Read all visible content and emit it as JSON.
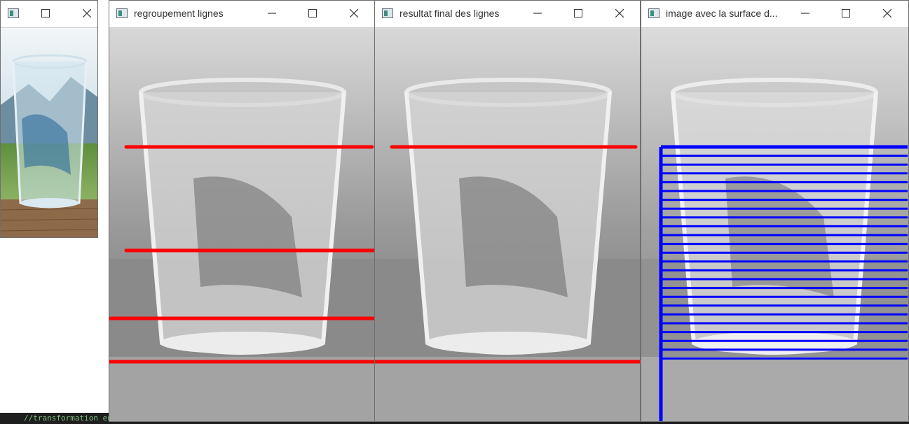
{
  "windows": [
    {
      "id": "original",
      "title": "",
      "image": "photo-glass-of-sparkling-water"
    },
    {
      "id": "grouping",
      "title": "regroupement lignes",
      "image": "grayscale-glass-with-red-lines"
    },
    {
      "id": "final",
      "title": "resultat final des lignes",
      "image": "grayscale-glass-with-red-lines"
    },
    {
      "id": "surface",
      "title": "image avec la surface d...",
      "image": "grayscale-glass-with-blue-surface-hatching"
    }
  ],
  "editor": {
    "code_text": "//transformation en gris"
  },
  "colors": {
    "line_red": "#ff0000",
    "surface_blue": "#0000ff",
    "titlebar": "#ffffff"
  },
  "icons": {
    "minimize": "minimize-icon",
    "maximize": "maximize-icon",
    "close": "close-icon",
    "app": "opencv-window-icon"
  }
}
